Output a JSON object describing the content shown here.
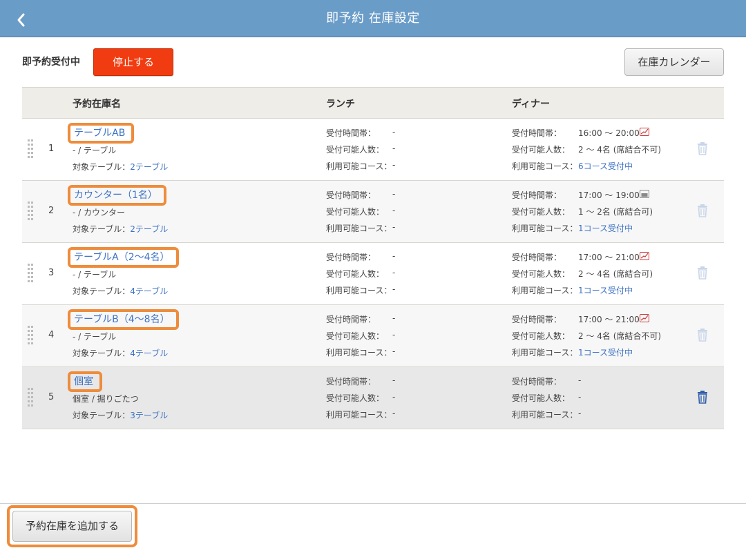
{
  "header": {
    "title": "即予約 在庫設定",
    "back_icon": "chevron-left-icon"
  },
  "toolbar": {
    "status_label": "即予約受付中",
    "stop_button": "停止する",
    "calendar_button": "在庫カレンダー"
  },
  "table": {
    "columns": [
      "予約在庫名",
      "ランチ",
      "ディナー"
    ],
    "labels": {
      "time": "受付時間帯：",
      "people": "受付可能人数：",
      "course": "利用可能コース：",
      "target_prefix": "対象テーブル："
    },
    "rows": [
      {
        "num": "1",
        "name": "テーブルAB",
        "type": "- / テーブル",
        "tables": "2テーブル",
        "lunch": {
          "time": "-",
          "people": "-",
          "course": "-"
        },
        "dinner": {
          "time": "16:00 〜 20:00",
          "people": "2 〜 4名 (席結合不可)",
          "course": "6コース受付中",
          "badge_color": "#cc3a3a"
        }
      },
      {
        "num": "2",
        "name": "カウンター（1名）",
        "type": "- / カウンター",
        "tables": "2テーブル",
        "lunch": {
          "time": "-",
          "people": "-",
          "course": "-"
        },
        "dinner": {
          "time": "17:00 〜 19:00",
          "people": "1 〜 2名 (席結合可)",
          "course": "1コース受付中",
          "badge_color": "#888888"
        }
      },
      {
        "num": "3",
        "name": "テーブルA（2〜4名）",
        "type": "- / テーブル",
        "tables": "4テーブル",
        "lunch": {
          "time": "-",
          "people": "-",
          "course": "-"
        },
        "dinner": {
          "time": "17:00 〜 21:00",
          "people": "2 〜 4名 (席結合可)",
          "course": "1コース受付中",
          "badge_color": "#cc3a3a"
        }
      },
      {
        "num": "4",
        "name": "テーブルB（4〜8名）",
        "type": "- / テーブル",
        "tables": "4テーブル",
        "lunch": {
          "time": "-",
          "people": "-",
          "course": "-"
        },
        "dinner": {
          "time": "17:00 〜 21:00",
          "people": "2 〜 4名 (席結合不可)",
          "course": "1コース受付中",
          "badge_color": "#cc3a3a"
        }
      },
      {
        "num": "5",
        "name": "個室",
        "type": "個室 / 掘りごたつ",
        "tables": "3テーブル",
        "lunch": {
          "time": "-",
          "people": "-",
          "course": "-"
        },
        "dinner": {
          "time": "-",
          "people": "-",
          "course": "-"
        }
      }
    ]
  },
  "footer": {
    "add_button": "予約在庫を追加する"
  },
  "colors": {
    "header": "#6a9cc8",
    "stop": "#f03c10",
    "link": "#3d72c4",
    "highlight": "#ee8c3c",
    "trash_active": "#2e5ea8",
    "trash_disabled": "#c9d6e8"
  }
}
